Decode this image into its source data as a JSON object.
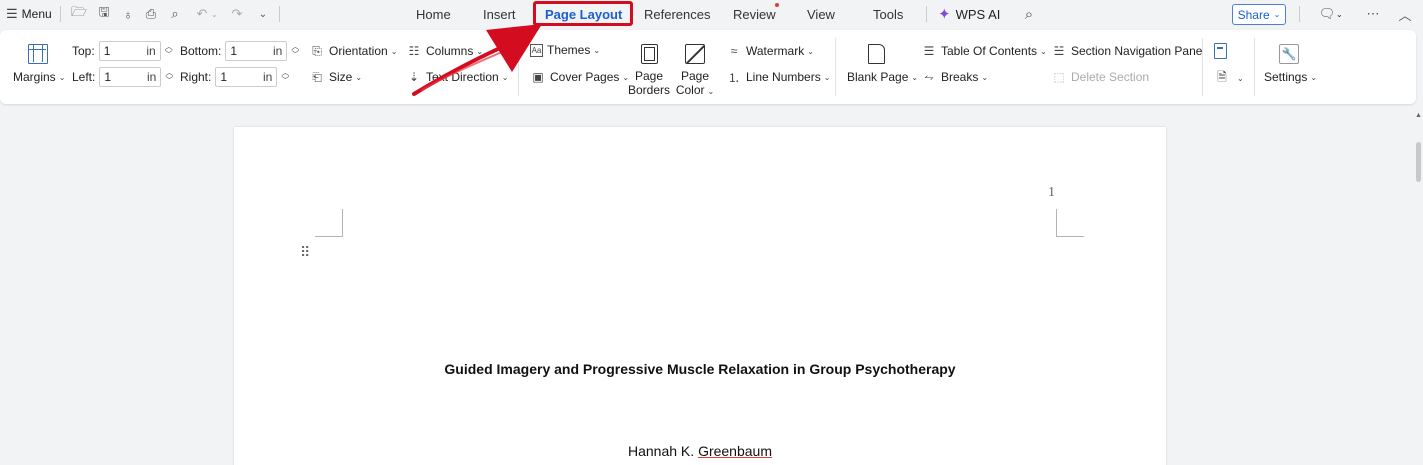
{
  "quick_access": {
    "menu_label": "Menu",
    "icons": [
      "hamburger-icon",
      "open-folder-icon",
      "save-icon",
      "format-painter-icon",
      "print-icon",
      "print-preview-icon",
      "undo-icon",
      "redo-icon",
      "customize-dropdown-icon"
    ]
  },
  "tabs": [
    {
      "label": "Home"
    },
    {
      "label": "Insert"
    },
    {
      "label": "Page Layout",
      "active": true
    },
    {
      "label": "References"
    },
    {
      "label": "Review",
      "badge": true
    },
    {
      "label": "View"
    },
    {
      "label": "Tools"
    }
  ],
  "wps_ai_label": "WPS AI",
  "share_label": "Share",
  "ribbon": {
    "margins_label": "Margins",
    "top_label": "Top:",
    "top_value": "1",
    "bottom_label": "Bottom:",
    "bottom_value": "1",
    "left_label": "Left:",
    "left_value": "1",
    "right_label": "Right:",
    "right_value": "1",
    "unit": "in",
    "orientation_label": "Orientation",
    "size_label": "Size",
    "columns_label": "Columns",
    "text_direction_label": "Text Direction",
    "themes_label": "Themes",
    "cover_pages_label": "Cover Pages",
    "page_borders_line1": "Page",
    "page_borders_line2": "Borders",
    "page_color_line1": "Page",
    "page_color_line2": "Color",
    "watermark_label": "Watermark",
    "line_numbers_label": "Line Numbers",
    "blank_page_label": "Blank Page",
    "toc_label": "Table Of Contents",
    "breaks_label": "Breaks",
    "section_nav_label": "Section Navigation Pane",
    "delete_section_label": "Delete Section",
    "settings_label": "Settings"
  },
  "document": {
    "page_number": "1",
    "title": "Guided Imagery and Progressive Muscle Relaxation in Group Psychotherapy",
    "author_first": "Hannah K.",
    "author_last": "Greenbaum"
  },
  "colors": {
    "accent": "#1a5fd1",
    "highlight_box": "#d40c1f",
    "arrow": "#d40c1f"
  }
}
